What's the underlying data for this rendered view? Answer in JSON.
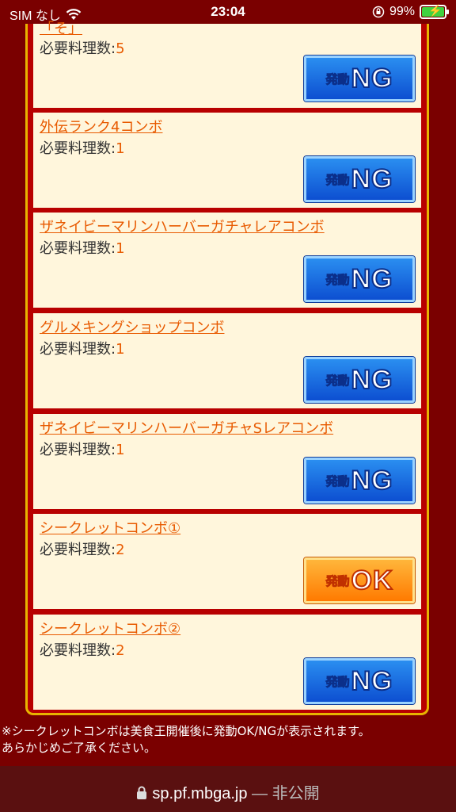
{
  "status": {
    "carrier": "SIM なし",
    "time": "23:04",
    "battery_pct": "99%",
    "battery_color": "#3fd23f"
  },
  "combos": {
    "req_label": "必要料理数:",
    "items": [
      {
        "title": "「そ」",
        "req": "5",
        "status": "NG"
      },
      {
        "title": "外伝ランク4コンボ",
        "req": "1",
        "status": "NG"
      },
      {
        "title": "ザネイビーマリンハーバーガチャレアコンボ",
        "req": "1",
        "status": "NG"
      },
      {
        "title": "グルメキングショップコンボ",
        "req": "1",
        "status": "NG"
      },
      {
        "title": "ザネイビーマリンハーバーガチャSレアコンボ",
        "req": "1",
        "status": "NG"
      },
      {
        "title": "シークレットコンボ①",
        "req": "2",
        "status": "OK"
      },
      {
        "title": "シークレットコンボ②",
        "req": "2",
        "status": "NG"
      }
    ],
    "badge_prefix": "発動"
  },
  "note": {
    "line1": "※シークレットコンボは美食王開催後に発動OK/NGが表示されます。",
    "line2": "あらかじめご了承ください。"
  },
  "urlbar": {
    "domain": "sp.pf.mbga.jp",
    "suffix": "— 非公開"
  },
  "colors": {
    "background": "#7a0000",
    "panel": "#b80000",
    "card": "#fff6dc",
    "link": "#e85a00",
    "ng_badge": "#1a6fe0",
    "ok_badge": "#ff9a1a"
  }
}
